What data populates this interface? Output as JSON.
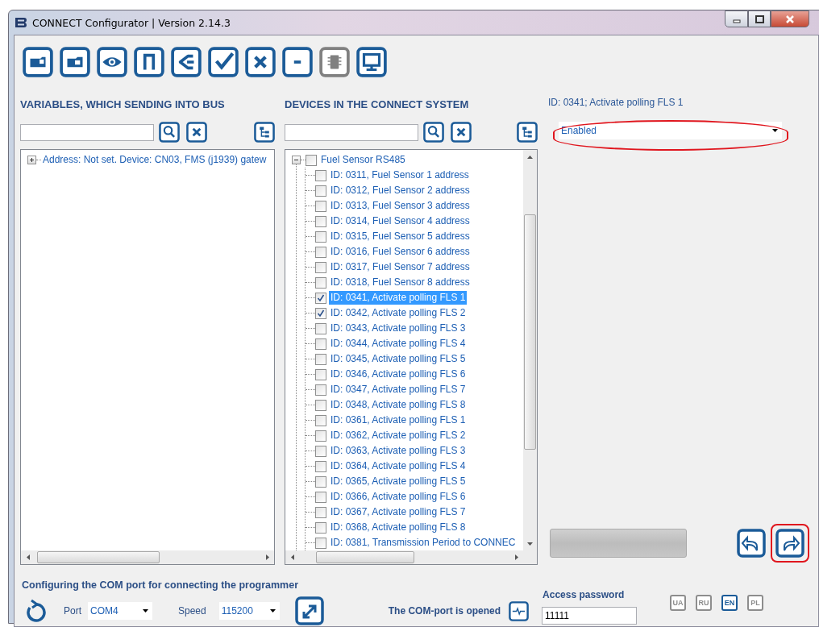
{
  "window": {
    "title": "CONNECT Configurator | Version 2.14.3"
  },
  "toolbar": [
    {
      "kind": "import",
      "disabled": false
    },
    {
      "kind": "export",
      "disabled": false
    },
    {
      "kind": "view",
      "disabled": false
    },
    {
      "kind": "frame",
      "disabled": false
    },
    {
      "kind": "back",
      "disabled": false
    },
    {
      "kind": "check",
      "disabled": false
    },
    {
      "kind": "clear",
      "disabled": false
    },
    {
      "kind": "minus",
      "disabled": false
    },
    {
      "kind": "chip",
      "disabled": true
    },
    {
      "kind": "monitor",
      "disabled": false
    }
  ],
  "variables_panel": {
    "title": "VARIABLES, WHICH SENDING INTO BUS",
    "tree": [
      {
        "label": "Address: Not set. Device: CN03, FMS (j1939) gatew",
        "expanded": false,
        "selected": false
      }
    ]
  },
  "devices_panel": {
    "title": "DEVICES IN THE CONNECT SYSTEM",
    "tree": [
      {
        "label": "Fuel Sensor RS485",
        "expanded": true,
        "checked": false,
        "selected": false,
        "children": [
          {
            "label": "ID: 0311, Fuel Sensor 1 address",
            "checked": false,
            "selected": false
          },
          {
            "label": "ID: 0312, Fuel Sensor 2 address",
            "checked": false,
            "selected": false
          },
          {
            "label": "ID: 0313, Fuel Sensor 3 address",
            "checked": false,
            "selected": false
          },
          {
            "label": "ID: 0314, Fuel Sensor 4 address",
            "checked": false,
            "selected": false
          },
          {
            "label": "ID: 0315, Fuel Sensor 5 address",
            "checked": false,
            "selected": false
          },
          {
            "label": "ID: 0316, Fuel Sensor 6 address",
            "checked": false,
            "selected": false
          },
          {
            "label": "ID: 0317, Fuel Sensor 7 address",
            "checked": false,
            "selected": false
          },
          {
            "label": "ID: 0318, Fuel Sensor 8 address",
            "checked": false,
            "selected": false
          },
          {
            "label": "ID: 0341, Activate polling FLS 1",
            "checked": true,
            "selected": true
          },
          {
            "label": "ID: 0342, Activate polling FLS 2",
            "checked": true,
            "selected": false
          },
          {
            "label": "ID: 0343, Activate polling FLS 3",
            "checked": false,
            "selected": false
          },
          {
            "label": "ID: 0344, Activate polling FLS 4",
            "checked": false,
            "selected": false
          },
          {
            "label": "ID: 0345, Activate polling FLS 5",
            "checked": false,
            "selected": false
          },
          {
            "label": "ID: 0346, Activate polling FLS 6",
            "checked": false,
            "selected": false
          },
          {
            "label": "ID: 0347, Activate polling FLS 7",
            "checked": false,
            "selected": false
          },
          {
            "label": "ID: 0348, Activate polling FLS 8",
            "checked": false,
            "selected": false
          },
          {
            "label": "ID: 0361, Activate polling FLS 1",
            "checked": false,
            "selected": false
          },
          {
            "label": "ID: 0362, Activate polling FLS 2",
            "checked": false,
            "selected": false
          },
          {
            "label": "ID: 0363, Activate polling FLS 3",
            "checked": false,
            "selected": false
          },
          {
            "label": "ID: 0364, Activate polling FLS 4",
            "checked": false,
            "selected": false
          },
          {
            "label": "ID: 0365, Activate polling FLS 5",
            "checked": false,
            "selected": false
          },
          {
            "label": "ID: 0366, Activate polling FLS 6",
            "checked": false,
            "selected": false
          },
          {
            "label": "ID: 0367, Activate polling FLS 7",
            "checked": false,
            "selected": false
          },
          {
            "label": "ID: 0368, Activate polling FLS 8",
            "checked": false,
            "selected": false
          },
          {
            "label": "ID: 0381, Transmission Period to CONNEC",
            "checked": false,
            "selected": false
          }
        ]
      }
    ]
  },
  "parameter": {
    "label": "ID: 0341; Activate polling FLS 1",
    "value": "Enabled",
    "highlighted": true
  },
  "nav_buttons": [
    {
      "kind": "back",
      "highlighted": false
    },
    {
      "kind": "forward",
      "highlighted": true
    }
  ],
  "com_port": {
    "title": "Configuring the COM port for connecting the programmer",
    "port_label": "Port",
    "port": "COM4",
    "speed_label": "Speed",
    "speed": "115200"
  },
  "status": "The COM-port is opened",
  "password": {
    "label": "Access password",
    "value": "11111"
  },
  "languages": [
    {
      "label": "UA",
      "selected": false
    },
    {
      "label": "RU",
      "selected": false
    },
    {
      "label": "EN",
      "selected": true
    },
    {
      "label": "PL",
      "selected": false
    }
  ]
}
